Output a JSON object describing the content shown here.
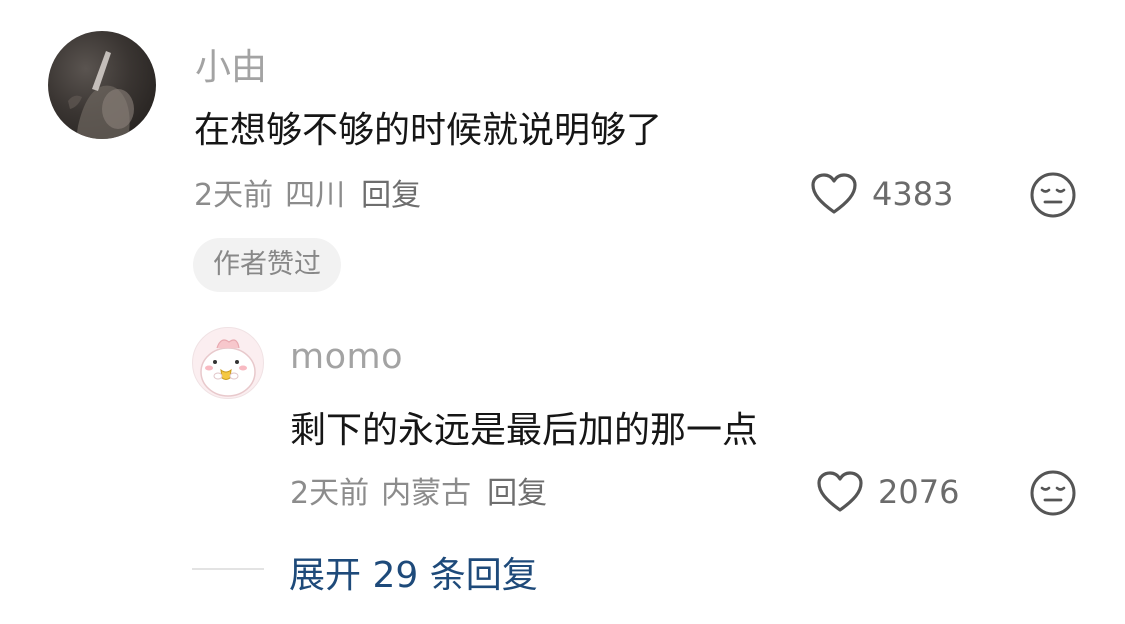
{
  "comment": {
    "username": "小由",
    "text": "在想够不够的时候就说明够了",
    "time": "2天前",
    "location": "四川",
    "reply_label": "回复",
    "likes": "4383",
    "badge": "作者赞过",
    "like_icon": "heart-outline-icon",
    "emoji_icon": "emoji-face-icon"
  },
  "reply": {
    "username": "momo",
    "text": "剩下的永远是最后加的那一点",
    "time": "2天前",
    "location": "内蒙古",
    "reply_label": "回复",
    "likes": "2076",
    "like_icon": "heart-outline-icon",
    "emoji_icon": "emoji-face-icon"
  },
  "expand": {
    "label": "展开 29 条回复"
  },
  "colors": {
    "username": "#a3a3a3",
    "meta": "#8c8c8c",
    "link": "#1e4a7a",
    "badge_bg": "#f2f2f2"
  }
}
